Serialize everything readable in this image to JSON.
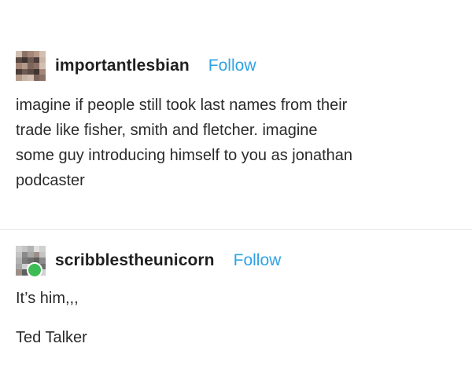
{
  "colors": {
    "follow": "#2fa3e6",
    "online_dot": "#3dbb55"
  },
  "posts": [
    {
      "username": "importantlesbian",
      "follow_label": "Follow",
      "avatar_icon": "pixelated-avatar",
      "lines": [
        "imagine if people still took last names from their",
        "trade like fisher, smith and fletcher. imagine",
        "some guy introducing himself to you as jonathan",
        "podcaster"
      ]
    },
    {
      "username": "scribblestheunicorn",
      "follow_label": "Follow",
      "avatar_icon": "pixelated-avatar-online",
      "lines": [
        "It’s him,,,",
        "Ted Talker"
      ]
    }
  ]
}
